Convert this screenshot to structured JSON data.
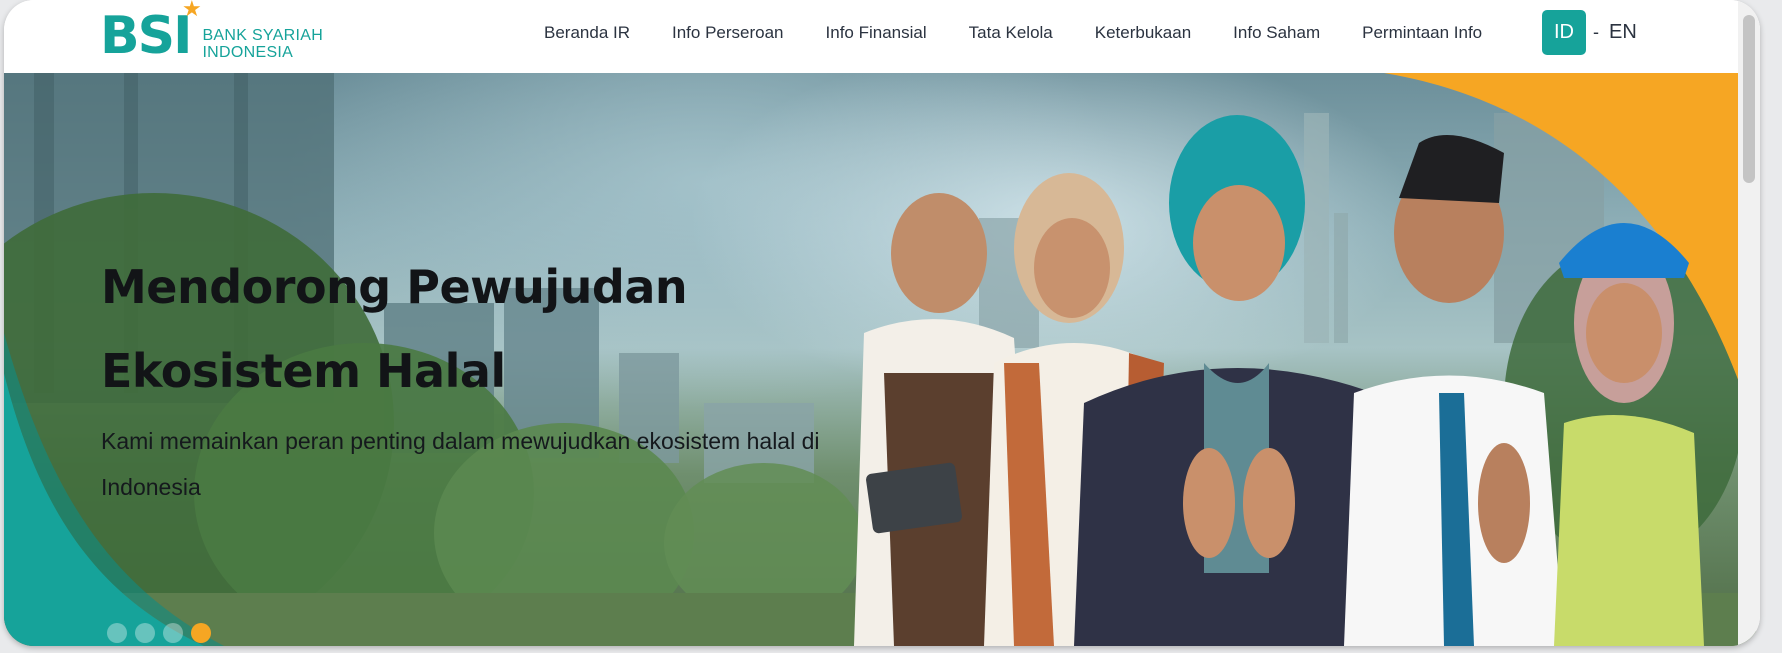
{
  "brand": {
    "logo_mark": "BSI",
    "logo_line1": "BANK SYARIAH",
    "logo_line2": "INDONESIA",
    "accent": "#16a39a",
    "secondary": "#f6a623"
  },
  "nav": {
    "items": [
      "Beranda IR",
      "Info Perseroan",
      "Info Finansial",
      "Tata Kelola",
      "Keterbukaan",
      "Info Saham",
      "Permintaan Info"
    ]
  },
  "lang": {
    "active": "ID",
    "separator": "-",
    "other": "EN"
  },
  "hero": {
    "title": "Mendorong Pewujudan Ekosistem Halal",
    "subtitle": "Kami memainkan peran penting dalam mewujudkan ekosistem halal di Indonesia",
    "slides_total": 4,
    "slide_active_index": 3
  }
}
